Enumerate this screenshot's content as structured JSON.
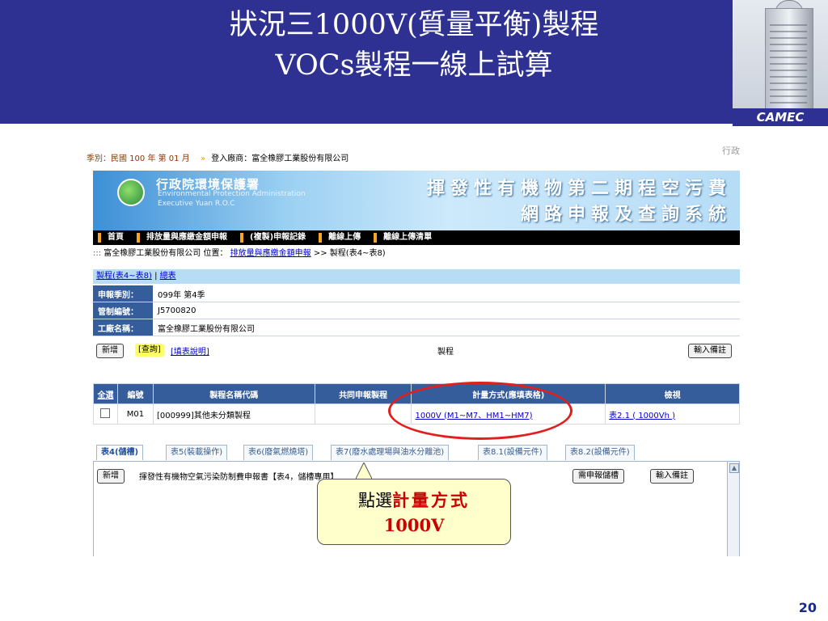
{
  "slide": {
    "title_line1": "狀況三1000V(質量平衡)製程",
    "title_line2": "VOCs製程一線上試算",
    "brand": "CAMEC",
    "page_number": "20",
    "colors": {
      "header": "#2e3192",
      "highlight_red": "#e0201e",
      "callout_fill": "#ffffcc"
    }
  },
  "screenshot": {
    "top_info": {
      "season": "季別：民國 100 年 第 01 月",
      "login": "登入廠商：富全橡膠工業股份有限公司",
      "right_cut": "行政"
    },
    "banner": {
      "agency_zh": "行政院環境保護署",
      "agency_en1": "Environmental Protection Administration",
      "agency_en2": "Executive Yuan R.O.C",
      "system_title_line1": "揮發性有機物第二期程空污費",
      "system_title_line2": "網路申報及查詢系統"
    },
    "nav": [
      "首頁",
      "排放量與應繳金額申報",
      "(複製)申報記錄",
      "離線上傳",
      "離線上傳清單"
    ],
    "breadcrumb": {
      "prefix": ":::",
      "company_position": "富全橡膠工業股份有限公司 位置：",
      "link": "排放量與應繳金額申報",
      "rest": ">> 製程(表4~表8)"
    },
    "subtabs": {
      "link1": "製程(表4~表8)",
      "separator": "|",
      "link2": "總表"
    },
    "info": [
      {
        "label": "申報季別：",
        "value": "099年 第4季"
      },
      {
        "label": "管制編號：",
        "value": "J5700820"
      },
      {
        "label": "工廠名稱：",
        "value": "富全橡膠工業股份有限公司"
      }
    ],
    "actions": {
      "add": "新增",
      "query": "[查詢]",
      "help": "[填表說明]",
      "process_label": "製程",
      "note": "輸入備註"
    },
    "table": {
      "headers": [
        "全選",
        "編號",
        "製程名稱代碼",
        "共同申報製程",
        "計量方式(應填表格)",
        "檢視"
      ],
      "rows": [
        {
          "id": "M01",
          "name": "[000999]其他未分類製程",
          "shared": "",
          "method": "1000V (M1~M7、HM1~HM7)",
          "view": "表2.1 ( 1000Vh )"
        }
      ]
    },
    "lower_tabs": [
      "表4(儲槽)",
      "表5(裝載操作)",
      "表6(廢氣燃燒塔)",
      "表7(廢水處理場與油水分離池)",
      "表8.1(設備元件)",
      "表8.2(設備元件)"
    ],
    "lower_panel": {
      "add": "新增",
      "desc": "揮發性有機物空氣污染防制費申報書【表4，儲槽專用】",
      "need_btn": "需申報儲槽",
      "note_btn": "輸入備註"
    }
  },
  "callout": {
    "prefix": "點選",
    "emphasis": "計量方式",
    "line2": "1000V"
  }
}
